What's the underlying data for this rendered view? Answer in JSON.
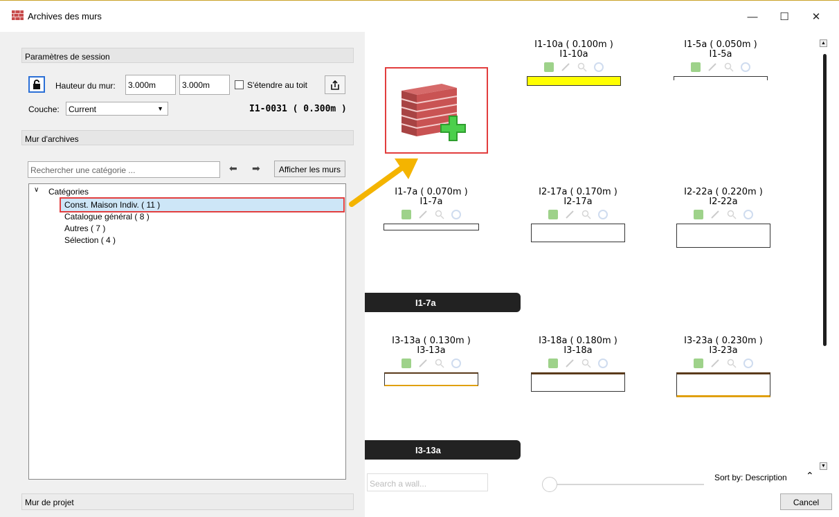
{
  "window": {
    "title": "Archives des murs",
    "minimize": "—",
    "maximize": "☐",
    "close": "✕"
  },
  "session": {
    "header": "Paramètres de session",
    "wall_height_label": "Hauteur du mur:",
    "height_value_1": "3.000m",
    "height_value_2": "3.000m",
    "extend_roof_label": "S'étendre au toit",
    "extend_roof_checked": false,
    "layer_label": "Couche:",
    "layer_value": "Current",
    "current_wall": "I1-0031 ( 0.300m )"
  },
  "archive": {
    "header": "Mur d'archives",
    "search_placeholder": "Rechercher une catégorie ...",
    "show_walls_button": "Afficher les murs",
    "tree_root": "Catégories",
    "categories": [
      {
        "label": "Const. Maison Indiv. ( 11 )",
        "selected": true
      },
      {
        "label": "Catalogue général ( 8 )",
        "selected": false
      },
      {
        "label": "Autres ( 7 )",
        "selected": false
      },
      {
        "label": "Sélection ( 4 )",
        "selected": false
      }
    ]
  },
  "project": {
    "header": "Mur de projet"
  },
  "walls": [
    {
      "title": "I1-10a ( 0.100m )",
      "code": "I1-10a"
    },
    {
      "title": "I1-5a ( 0.050m )",
      "code": "I1-5a"
    },
    {
      "title": "I1-7a ( 0.070m )",
      "code": "I1-7a"
    },
    {
      "title": "I2-17a ( 0.170m )",
      "code": "I2-17a"
    },
    {
      "title": "I2-22a ( 0.220m )",
      "code": "I2-22a"
    },
    {
      "title": "I3-13a ( 0.130m )",
      "code": "I3-13a"
    },
    {
      "title": "I3-18a ( 0.180m )",
      "code": "I3-18a"
    },
    {
      "title": "I3-23a ( 0.230m )",
      "code": "I3-23a"
    }
  ],
  "group_bars": [
    "I1-7a",
    "I3-13a"
  ],
  "footer": {
    "search_placeholder": "Search a wall...",
    "sort_label": "Sort by: Description",
    "cancel_button": "Cancel"
  },
  "colors": {
    "selection_border": "#e23d3d",
    "selection_fill": "#cde6f7",
    "accent_blue": "#2a6fd6",
    "swatch_yellow": "#ffff00",
    "arrow_orange": "#f4b400",
    "group_bar": "#222222"
  }
}
